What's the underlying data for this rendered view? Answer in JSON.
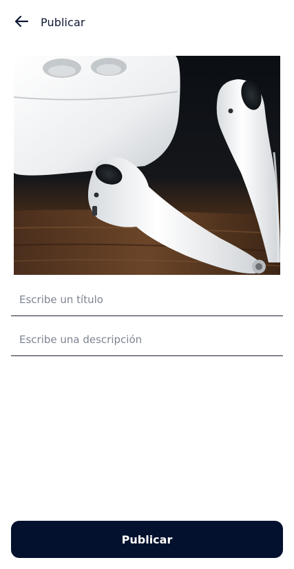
{
  "header": {
    "back_icon": "arrow-left-icon",
    "title": "Publicar"
  },
  "image": {
    "subject": "airpods-photo"
  },
  "form": {
    "title_placeholder": "Escribe un título",
    "title_value": "",
    "description_placeholder": "Escribe una descripción",
    "description_value": ""
  },
  "actions": {
    "publish_label": "Publicar"
  },
  "colors": {
    "primary": "#03112e",
    "text": "#0d1733",
    "placeholder": "#7d8390",
    "divider": "#1a1f2b"
  }
}
